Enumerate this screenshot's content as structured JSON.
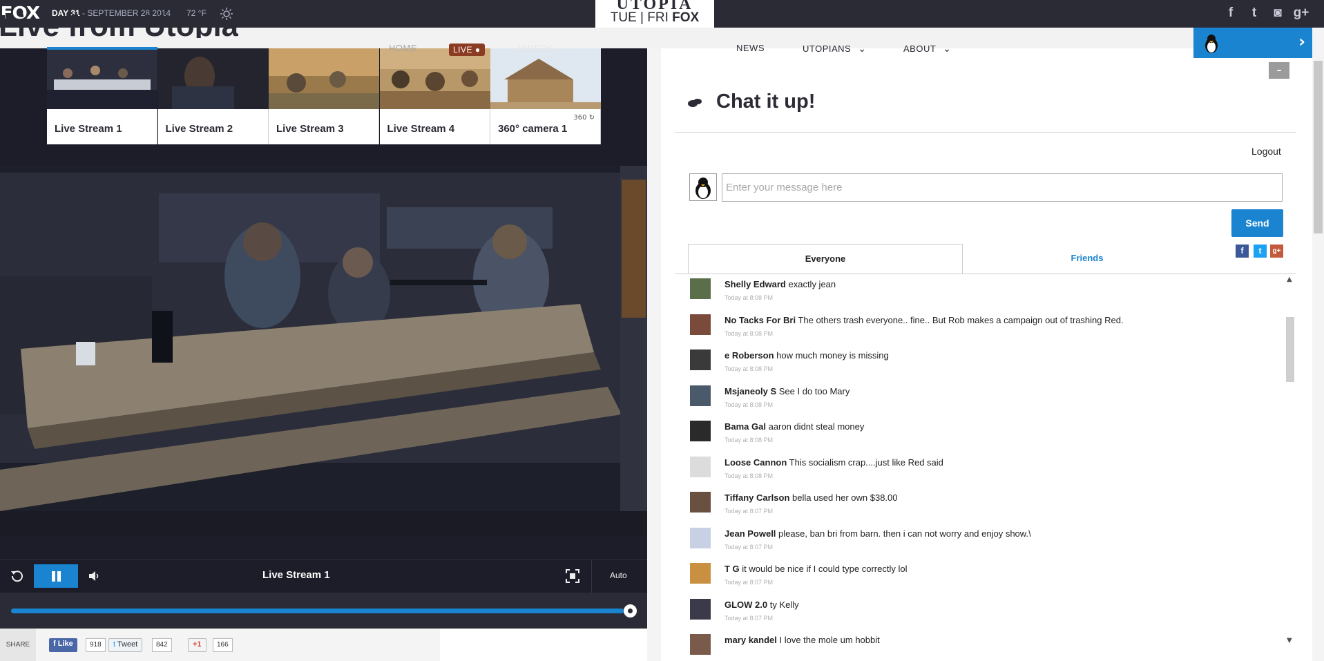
{
  "topbar": {
    "logo": "FOX",
    "day": "DAY 31",
    "date_sep": " - ",
    "date": "SEPTEMBER 28 2014",
    "temp": "72 °F",
    "show_logo": "UTOPIA",
    "schedule_days": "TUE | FRI",
    "schedule_network": "FOX",
    "social": [
      "facebook-icon",
      "twitter-icon",
      "instagram-icon",
      "google-plus-icon"
    ]
  },
  "page_title": "Live from Utopia",
  "nav": {
    "home": "HOME",
    "live": "LIVE",
    "videos": "VIDEOS",
    "news": "NEWS",
    "utopians": "UTOPIANS",
    "about": "ABOUT"
  },
  "thumbnails": [
    {
      "label": "Live Stream 1",
      "active": true
    },
    {
      "label": "Live Stream 2"
    },
    {
      "label": "Live Stream 3"
    },
    {
      "label": "Live Stream 4"
    },
    {
      "label": "360° camera 1",
      "tag": "360"
    }
  ],
  "player": {
    "stream_title": "Live Stream 1",
    "quality": "Auto",
    "progress_fraction": 0.99
  },
  "share": {
    "label": "SHARE",
    "like_label": "Like",
    "like_count": "918",
    "tweet_label": "Tweet",
    "tweet_count": "842",
    "gplus_label": "+1",
    "gplus_count": "166"
  },
  "chat": {
    "title": "Chat it up!",
    "logout": "Logout",
    "input_placeholder": "Enter your message here",
    "send": "Send",
    "tabs": [
      "Everyone",
      "Friends"
    ],
    "share_icons": [
      "facebook-icon",
      "twitter-icon",
      "google-plus-icon"
    ],
    "messages": [
      {
        "user": "Shelly Edward",
        "text": " exactly jean",
        "time": "Today at 8:08 PM",
        "color": "#5a6e4a"
      },
      {
        "user": "No Tacks For Bri",
        "text": "  The others trash everyone.. fine.. But Rob makes a campaign out of trashing Red.",
        "time": "Today at 8:08 PM",
        "color": "#7a4a3a"
      },
      {
        "user": "e Roberson",
        "text": " how much money is missing",
        "time": "Today at 8:08 PM",
        "color": "#3a3a3a"
      },
      {
        "user": "Msjaneoly S",
        "text": " See I do too Mary",
        "time": "Today at 8:08 PM",
        "color": "#4a5a6a"
      },
      {
        "user": "Bama Gal",
        "text": " aaron didnt steal money",
        "time": "Today at 8:08 PM",
        "color": "#2a2a2a"
      },
      {
        "user": "Loose Cannon",
        "text": " This socialism crap....just like Red said",
        "time": "Today at 8:08 PM",
        "color": "#dcdcdc"
      },
      {
        "user": "Tiffany Carlson",
        "text": " bella used her own $38.00",
        "time": "Today at 8:07 PM",
        "color": "#6a5040"
      },
      {
        "user": "Jean Powell",
        "text": " please, ban bri from barn. then i can not worry and enjoy show.\\",
        "time": "Today at 8:07 PM",
        "color": "#c8d0e4"
      },
      {
        "user": "T G",
        "text": " it would be nice if I could type correctly lol",
        "time": "Today at 8:07 PM",
        "color": "#c89040"
      },
      {
        "user": "GLOW 2.0",
        "text": " ty Kelly",
        "time": "Today at 8:07 PM",
        "color": "#3a3a4a"
      },
      {
        "user": "mary kandel",
        "text": " I love the mole um hobbit",
        "time": "",
        "color": "#7a5a4a"
      }
    ]
  },
  "colors": {
    "accent": "#1a84d0",
    "dark": "#1d1d29",
    "live": "#8c3b23"
  }
}
